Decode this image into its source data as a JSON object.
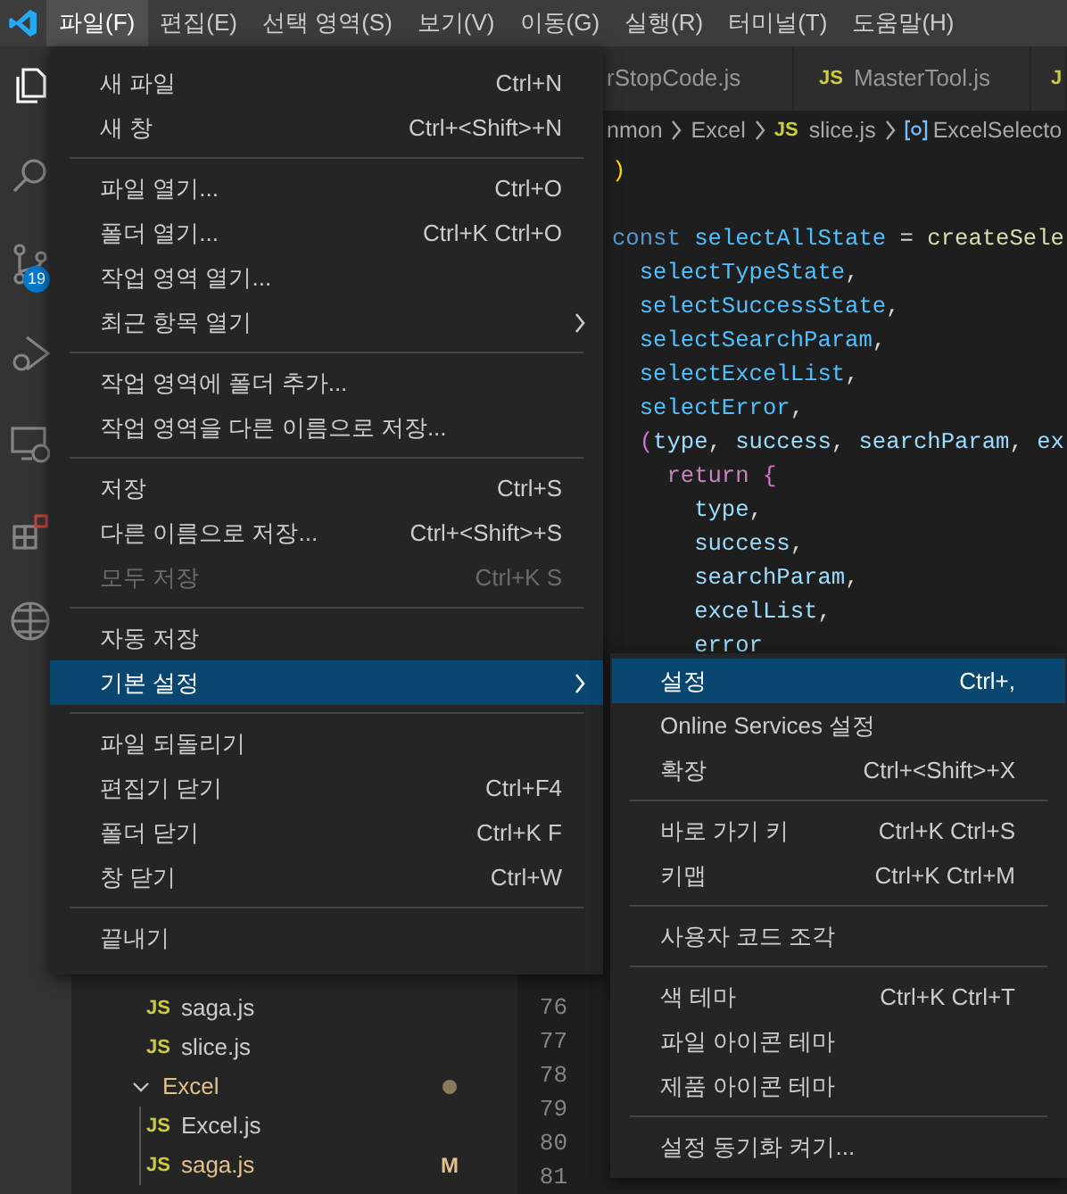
{
  "menu_bar": {
    "items": [
      {
        "label": "파일(F)",
        "selected": true
      },
      {
        "label": "편집(E)",
        "selected": false
      },
      {
        "label": "선택 영역(S)",
        "selected": false
      },
      {
        "label": "보기(V)",
        "selected": false
      },
      {
        "label": "이동(G)",
        "selected": false
      },
      {
        "label": "실행(R)",
        "selected": false
      },
      {
        "label": "터미널(T)",
        "selected": false
      },
      {
        "label": "도움말(H)",
        "selected": false
      }
    ]
  },
  "activity_bar": {
    "source_control_badge": "19"
  },
  "tabs": [
    {
      "label": "rStopCode.js"
    },
    {
      "icon": "JS",
      "label": "MasterTool.js"
    },
    {
      "icon": "J"
    }
  ],
  "breadcrumb": [
    {
      "kind": "folder",
      "label": "nmon"
    },
    {
      "kind": "folder",
      "label": "Excel"
    },
    {
      "kind": "file",
      "icon": "JS",
      "label": "slice.js"
    },
    {
      "kind": "symbol",
      "label": "ExcelSelecto"
    }
  ],
  "code_lines": [
    {
      "kind": "code",
      "tokens": [
        {
          "t": ")",
          "kind": "bracket1"
        }
      ]
    },
    {
      "kind": "blank"
    },
    {
      "kind": "code",
      "tokens": [
        {
          "t": "const",
          "kind": "keyword"
        },
        {
          "t": " selectAllState",
          "kind": "constant"
        },
        {
          "t": " = ",
          "kind": "punct"
        },
        {
          "t": "createSele",
          "kind": "function"
        }
      ]
    },
    {
      "kind": "code",
      "tokens": [
        {
          "t": "  selectTypeState",
          "kind": "constant"
        },
        {
          "t": ",",
          "kind": "punct"
        }
      ]
    },
    {
      "kind": "code",
      "tokens": [
        {
          "t": "  selectSuccessState",
          "kind": "constant"
        },
        {
          "t": ",",
          "kind": "punct"
        }
      ]
    },
    {
      "kind": "code",
      "tokens": [
        {
          "t": "  selectSearchParam",
          "kind": "constant"
        },
        {
          "t": ",",
          "kind": "punct"
        }
      ]
    },
    {
      "kind": "code",
      "tokens": [
        {
          "t": "  selectExcelList",
          "kind": "constant"
        },
        {
          "t": ",",
          "kind": "punct"
        }
      ]
    },
    {
      "kind": "code",
      "tokens": [
        {
          "t": "  selectError",
          "kind": "constant"
        },
        {
          "t": ",",
          "kind": "punct"
        }
      ]
    },
    {
      "kind": "code",
      "tokens": [
        {
          "t": "  (",
          "kind": "bracket2"
        },
        {
          "t": "type",
          "kind": "param"
        },
        {
          "t": ", ",
          "kind": "punct"
        },
        {
          "t": "success",
          "kind": "param"
        },
        {
          "t": ", ",
          "kind": "punct"
        },
        {
          "t": "searchParam",
          "kind": "param"
        },
        {
          "t": ", ",
          "kind": "punct"
        },
        {
          "t": "ex",
          "kind": "param"
        }
      ]
    },
    {
      "kind": "code",
      "tokens": [
        {
          "t": "    return",
          "kind": "control"
        },
        {
          "t": " {",
          "kind": "bracket2"
        }
      ]
    },
    {
      "kind": "code",
      "tokens": [
        {
          "t": "      type",
          "kind": "param"
        },
        {
          "t": ",",
          "kind": "punct"
        }
      ]
    },
    {
      "kind": "code",
      "tokens": [
        {
          "t": "      success",
          "kind": "param"
        },
        {
          "t": ",",
          "kind": "punct"
        }
      ]
    },
    {
      "kind": "code",
      "tokens": [
        {
          "t": "      searchParam",
          "kind": "param"
        },
        {
          "t": ",",
          "kind": "punct"
        }
      ]
    },
    {
      "kind": "code",
      "tokens": [
        {
          "t": "      excelList",
          "kind": "param"
        },
        {
          "t": ",",
          "kind": "punct"
        }
      ]
    },
    {
      "kind": "code",
      "tokens": [
        {
          "t": "      error",
          "kind": "param"
        }
      ]
    }
  ],
  "line_numbers": [
    "76",
    "77",
    "78",
    "79",
    "80",
    "81"
  ],
  "explorer": {
    "items": [
      {
        "kind": "group",
        "children": [
          {
            "kind": "file",
            "icon": "JS",
            "name": "saga.js",
            "modified": false
          },
          {
            "kind": "file",
            "icon": "JS",
            "name": "slice.js",
            "modified": false
          }
        ]
      },
      {
        "kind": "folder",
        "name": "Excel",
        "expanded": true,
        "modified": true,
        "children": [
          {
            "kind": "file",
            "icon": "JS",
            "name": "Excel.js",
            "modified": false
          },
          {
            "kind": "file",
            "icon": "JS",
            "name": "saga.js",
            "modified": true,
            "status": "M"
          }
        ]
      }
    ]
  },
  "file_menu": {
    "items": [
      {
        "kind": "item",
        "label": "새 파일",
        "shortcut": "Ctrl+N",
        "disabled": false,
        "selected": false,
        "submenu": false
      },
      {
        "kind": "item",
        "label": "새 창",
        "shortcut": "Ctrl+<Shift>+N",
        "disabled": false,
        "selected": false,
        "submenu": false
      },
      {
        "kind": "separator"
      },
      {
        "kind": "item",
        "label": "파일 열기...",
        "shortcut": "Ctrl+O",
        "disabled": false,
        "selected": false,
        "submenu": false
      },
      {
        "kind": "item",
        "label": "폴더 열기...",
        "shortcut": "Ctrl+K Ctrl+O",
        "disabled": false,
        "selected": false,
        "submenu": false
      },
      {
        "kind": "item",
        "label": "작업 영역 열기...",
        "disabled": false,
        "selected": false,
        "submenu": false
      },
      {
        "kind": "item",
        "label": "최근 항목 열기",
        "disabled": false,
        "selected": false,
        "submenu": true
      },
      {
        "kind": "separator"
      },
      {
        "kind": "item",
        "label": "작업 영역에 폴더 추가...",
        "disabled": false,
        "selected": false,
        "submenu": false
      },
      {
        "kind": "item",
        "label": "작업 영역을 다른 이름으로 저장...",
        "disabled": false,
        "selected": false,
        "submenu": false
      },
      {
        "kind": "separator"
      },
      {
        "kind": "item",
        "label": "저장",
        "shortcut": "Ctrl+S",
        "disabled": false,
        "selected": false,
        "submenu": false
      },
      {
        "kind": "item",
        "label": "다른 이름으로 저장...",
        "shortcut": "Ctrl+<Shift>+S",
        "disabled": false,
        "selected": false,
        "submenu": false
      },
      {
        "kind": "item",
        "label": "모두 저장",
        "shortcut": "Ctrl+K S",
        "disabled": true,
        "selected": false,
        "submenu": false
      },
      {
        "kind": "separator"
      },
      {
        "kind": "item",
        "label": "자동 저장",
        "disabled": false,
        "selected": false,
        "submenu": false
      },
      {
        "kind": "item",
        "label": "기본 설정",
        "disabled": false,
        "selected": true,
        "submenu": true
      },
      {
        "kind": "separator"
      },
      {
        "kind": "item",
        "label": "파일 되돌리기",
        "disabled": false,
        "selected": false,
        "submenu": false
      },
      {
        "kind": "item",
        "label": "편집기 닫기",
        "shortcut": "Ctrl+F4",
        "disabled": false,
        "selected": false,
        "submenu": false
      },
      {
        "kind": "item",
        "label": "폴더 닫기",
        "shortcut": "Ctrl+K F",
        "disabled": false,
        "selected": false,
        "submenu": false
      },
      {
        "kind": "item",
        "label": "창 닫기",
        "shortcut": "Ctrl+W",
        "disabled": false,
        "selected": false,
        "submenu": false
      },
      {
        "kind": "separator"
      },
      {
        "kind": "item",
        "label": "끝내기",
        "disabled": false,
        "selected": false,
        "submenu": false
      }
    ]
  },
  "preferences_submenu": {
    "items": [
      {
        "kind": "item",
        "label": "설정",
        "shortcut": "Ctrl+,",
        "selected": true
      },
      {
        "kind": "item",
        "label": "Online Services 설정",
        "selected": false
      },
      {
        "kind": "item",
        "label": "확장",
        "shortcut": "Ctrl+<Shift>+X",
        "selected": false
      },
      {
        "kind": "separator"
      },
      {
        "kind": "item",
        "label": "바로 가기 키",
        "shortcut": "Ctrl+K Ctrl+S",
        "selected": false
      },
      {
        "kind": "item",
        "label": "키맵",
        "shortcut": "Ctrl+K Ctrl+M",
        "selected": false
      },
      {
        "kind": "separator"
      },
      {
        "kind": "item",
        "label": "사용자 코드 조각",
        "selected": false
      },
      {
        "kind": "separator"
      },
      {
        "kind": "item",
        "label": "색 테마",
        "shortcut": "Ctrl+K Ctrl+T",
        "selected": false
      },
      {
        "kind": "item",
        "label": "파일 아이콘 테마",
        "selected": false
      },
      {
        "kind": "item",
        "label": "제품 아이콘 테마",
        "selected": false
      },
      {
        "kind": "separator"
      },
      {
        "kind": "item",
        "label": "설정 동기화 켜기...",
        "selected": false
      }
    ]
  }
}
